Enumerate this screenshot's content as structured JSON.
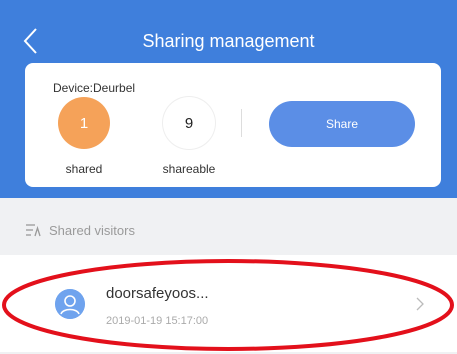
{
  "header": {
    "title": "Sharing management",
    "back_icon": "chevron-left-icon"
  },
  "device_card": {
    "device_label": "Device:Deurbel",
    "shared": {
      "count": "1",
      "label": "shared"
    },
    "shareable": {
      "count": "9",
      "label": "shareable"
    },
    "share_button": "Share"
  },
  "section": {
    "icon": "visitors-list-icon",
    "title": "Shared visitors"
  },
  "visitors": [
    {
      "name": "doorsafeyoos...",
      "time": "2019-01-19 15:17:00",
      "avatar_icon": "user-avatar-icon",
      "chevron_icon": "chevron-right-icon"
    }
  ],
  "colors": {
    "brand_blue": "#3f7fdc",
    "button_blue": "#5b8ee6",
    "shared_orange": "#f5a259",
    "annotation_red": "#e3101b"
  }
}
